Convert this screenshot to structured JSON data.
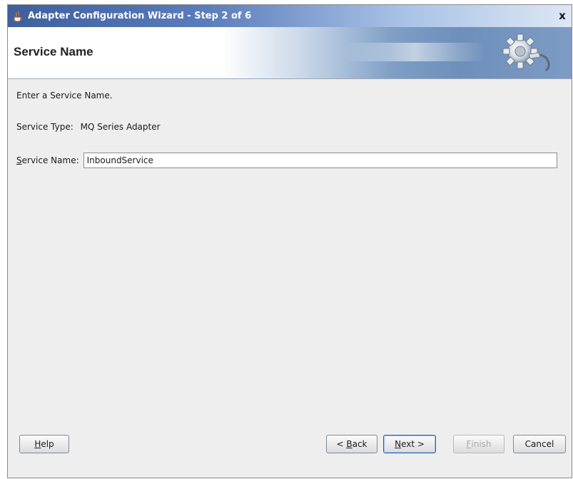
{
  "window": {
    "title": "Adapter Configuration Wizard - Step 2 of 6",
    "close_glyph": "x"
  },
  "banner": {
    "title": "Service Name"
  },
  "content": {
    "instruction": "Enter a Service Name.",
    "service_type_label": "Service Type:",
    "service_type_value": "MQ Series Adapter",
    "service_name_label_mnemonic": "S",
    "service_name_label_rest": "ervice Name:",
    "service_name_value": "InboundService"
  },
  "buttons": {
    "help_mn": "H",
    "help_rest": "elp",
    "back_pre": "< ",
    "back_mn": "B",
    "back_rest": "ack",
    "next_mn": "N",
    "next_rest": "ext >",
    "finish_mn": "F",
    "finish_rest": "inish",
    "cancel": "Cancel"
  }
}
